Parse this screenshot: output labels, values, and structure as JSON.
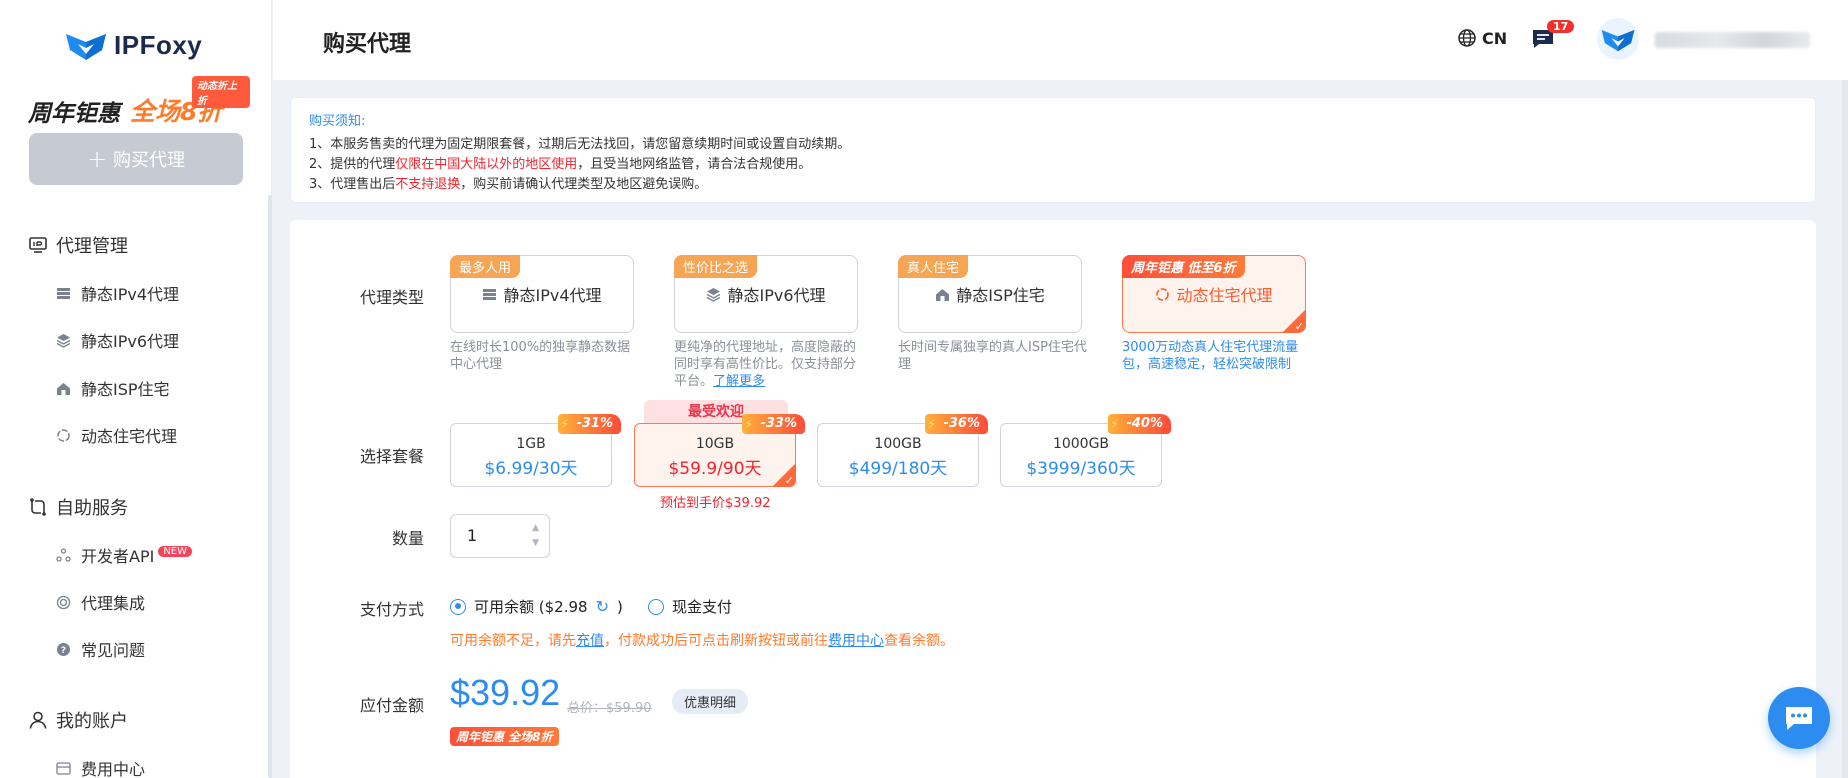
{
  "brand": {
    "name": "IPFoxy"
  },
  "sidebar": {
    "promo": {
      "text1": "周年钜惠",
      "text2": "全场8折",
      "tag": "动态折上折"
    },
    "buy_button": "购买代理",
    "groups": [
      {
        "label": "代理管理",
        "icon": "ip-monitor-icon"
      },
      {
        "label": "自助服务",
        "icon": "self-service-icon"
      },
      {
        "label": "我的账户",
        "icon": "user-icon"
      }
    ],
    "items_proxy": [
      {
        "label": "静态IPv4代理",
        "icon": "server-icon"
      },
      {
        "label": "静态IPv6代理",
        "icon": "layers-icon"
      },
      {
        "label": "静态ISP住宅",
        "icon": "home-icon"
      },
      {
        "label": "动态住宅代理",
        "icon": "refresh-cycle-icon"
      }
    ],
    "items_service": [
      {
        "label": "开发者API",
        "icon": "api-icon",
        "badge": "NEW"
      },
      {
        "label": "代理集成",
        "icon": "integration-icon"
      },
      {
        "label": "常见问题",
        "icon": "help-icon"
      }
    ],
    "items_account": [
      {
        "label": "费用中心",
        "icon": "billing-icon"
      }
    ]
  },
  "header": {
    "title": "购买代理",
    "lang": "CN",
    "msg_count": "17"
  },
  "notice": {
    "title": "购买须知:",
    "line1": "1、本服务售卖的代理为固定期限套餐，过期后无法找回，请您留意续期时间或设置自动续期。",
    "line2_pre": "2、提供的代理",
    "line2_red": "仅限在中国大陆以外的地区使用",
    "line2_post": "，且受当地网络监管，请合法合规使用。",
    "line3_pre": "3、代理售出后",
    "line3_red": "不支持退换",
    "line3_post": "，购买前请确认代理类型及地区避免误购。"
  },
  "form": {
    "type_label": "代理类型",
    "package_label": "选择套餐",
    "qty_label": "数量",
    "pay_label": "支付方式",
    "amount_label": "应付金额"
  },
  "types": [
    {
      "tag": "最多人用",
      "name": "静态IPv4代理",
      "desc": "在线时长100%的独享静态数据中心代理"
    },
    {
      "tag": "性价比之选",
      "name": "静态IPv6代理",
      "desc": "更纯净的代理地址，高度隐蔽的同时享有高性价比。仅支持部分平台。",
      "link": "了解更多"
    },
    {
      "tag": "真人住宅",
      "name": "静态ISP住宅",
      "desc": "长时间专属独享的真人ISP住宅代理"
    },
    {
      "tag": "周年钜惠 低至6折",
      "name": "动态住宅代理",
      "desc": "3000万动态真人住宅代理流量包，高速稳定，轻松突破限制"
    }
  ],
  "packages": [
    {
      "size": "1GB",
      "price": "$6.99/30天",
      "discount": "-31%"
    },
    {
      "size": "10GB",
      "price": "$59.9/90天",
      "discount": "-33%",
      "popular": "最受欢迎",
      "estimate": "预估到手价$39.92"
    },
    {
      "size": "100GB",
      "price": "$499/180天",
      "discount": "-36%"
    },
    {
      "size": "1000GB",
      "price": "$3999/360天",
      "discount": "-40%"
    }
  ],
  "quantity": "1",
  "payment": {
    "balance_label": "可用余额 ($2.98",
    "balance_close": ")",
    "cash_label": "现金支付",
    "note_pre": "可用余额不足，请先",
    "note_link1": "充值",
    "note_mid": "，付款成功后可点击刷新按钮或前往",
    "note_link2": "费用中心",
    "note_post": "查看余额。"
  },
  "amount": {
    "value": "$39.92",
    "original": "总价：$59.90",
    "detail": "优惠明细",
    "promo": "周年钜惠 全场8折"
  },
  "colors": {
    "accent": "#2d8cf0",
    "promo": "#ff6a3d",
    "danger": "#f5222d"
  }
}
